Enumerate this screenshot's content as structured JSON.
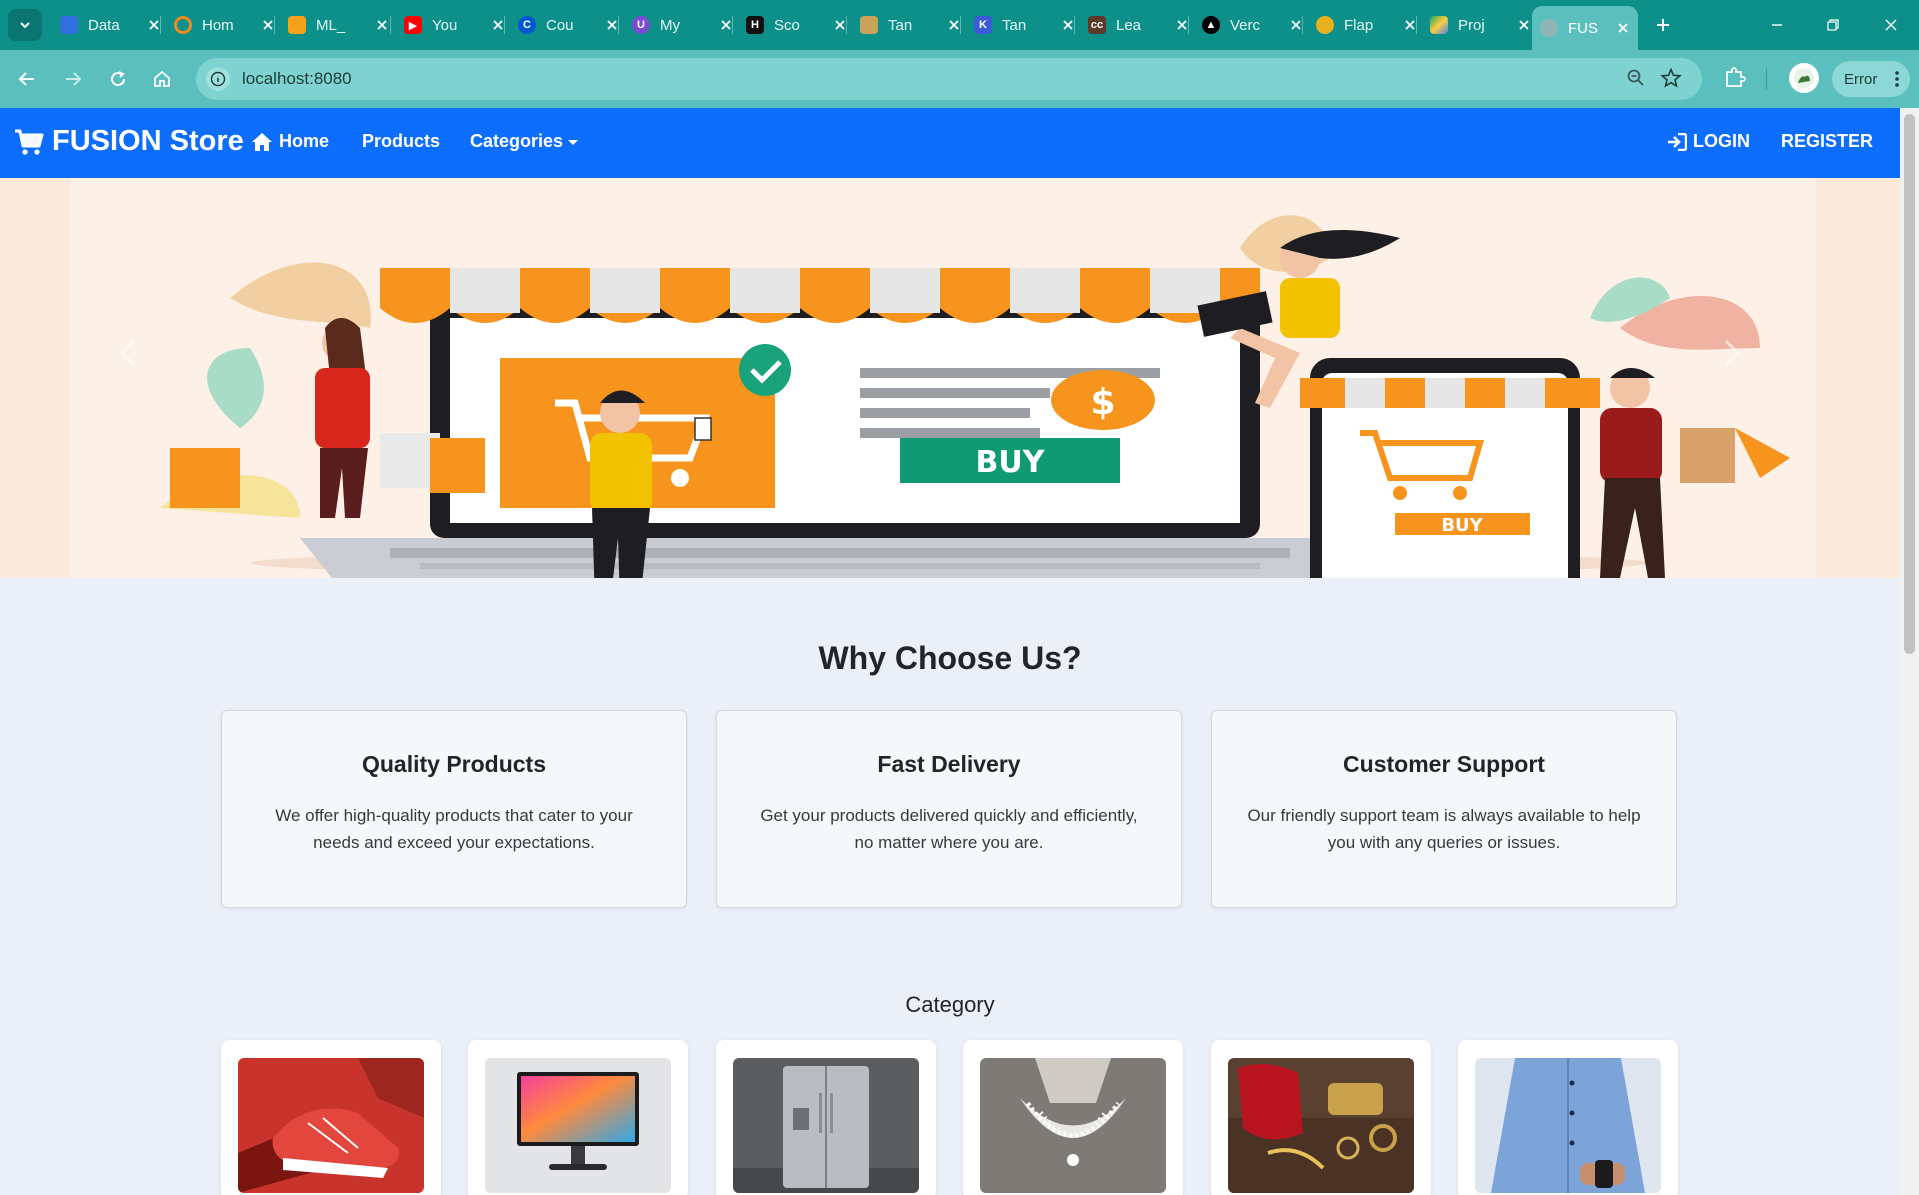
{
  "browser": {
    "tabs": [
      {
        "title": "Data",
        "icon": "copilot-icon",
        "color": "#2f6fdf"
      },
      {
        "title": "Hom",
        "icon": "ring-icon",
        "color": "#f08a24"
      },
      {
        "title": "ML_",
        "icon": "book-icon",
        "color": "#f7a21b"
      },
      {
        "title": "You",
        "icon": "youtube-icon",
        "color": "#ff0000"
      },
      {
        "title": "Cou",
        "icon": "coursera-icon",
        "color": "#0056d2"
      },
      {
        "title": "My",
        "icon": "unstop-icon",
        "color": "#7b4bd6"
      },
      {
        "title": "Sco",
        "icon": "hackerrank-icon",
        "color": "#111111"
      },
      {
        "title": "Tan",
        "icon": "tanstack-icon",
        "color": "#caa35a"
      },
      {
        "title": "Tan",
        "icon": "tanstack-k-icon",
        "color": "#3c5bd9"
      },
      {
        "title": "Lea",
        "icon": "codechef-icon",
        "color": "#5b3a29"
      },
      {
        "title": "Verc",
        "icon": "vercel-icon",
        "color": "#000000"
      },
      {
        "title": "Flap",
        "icon": "flappy-icon",
        "color": "#e8b21f"
      },
      {
        "title": "Proj",
        "icon": "drive-icon",
        "color": "#1fa463"
      },
      {
        "title": "FUS",
        "icon": "globe-icon",
        "color": "#7a9fa0",
        "active": true
      }
    ],
    "url": "localhost:8080",
    "error_label": "Error"
  },
  "navbar": {
    "brand": "FUSION Store",
    "links": {
      "home": "Home",
      "products": "Products",
      "categories": "Categories"
    },
    "login": "LOGIN",
    "register": "REGISTER"
  },
  "hero": {
    "buy_label": "BUY",
    "phone_buy_label": "BUY"
  },
  "why": {
    "title": "Why Choose Us?",
    "cards": [
      {
        "title": "Quality Products",
        "text": "We offer high-quality products that cater to your needs and exceed your expectations."
      },
      {
        "title": "Fast Delivery",
        "text": "Get your products delivered quickly and efficiently, no matter where you are."
      },
      {
        "title": "Customer Support",
        "text": "Our friendly support team is always available to help you with any queries or issues."
      }
    ]
  },
  "category": {
    "title": "Category",
    "items": [
      {
        "image": "sneaker-photo"
      },
      {
        "image": "monitor-photo"
      },
      {
        "image": "refrigerator-photo"
      },
      {
        "image": "necklace-photo"
      },
      {
        "image": "accessories-photo"
      },
      {
        "image": "shirt-photo"
      }
    ]
  },
  "colors": {
    "navbar": "#0d6efd",
    "tabstrip": "#0d8f8a",
    "toolbar": "#5bbfbd",
    "page_bg": "#ebeff8"
  }
}
